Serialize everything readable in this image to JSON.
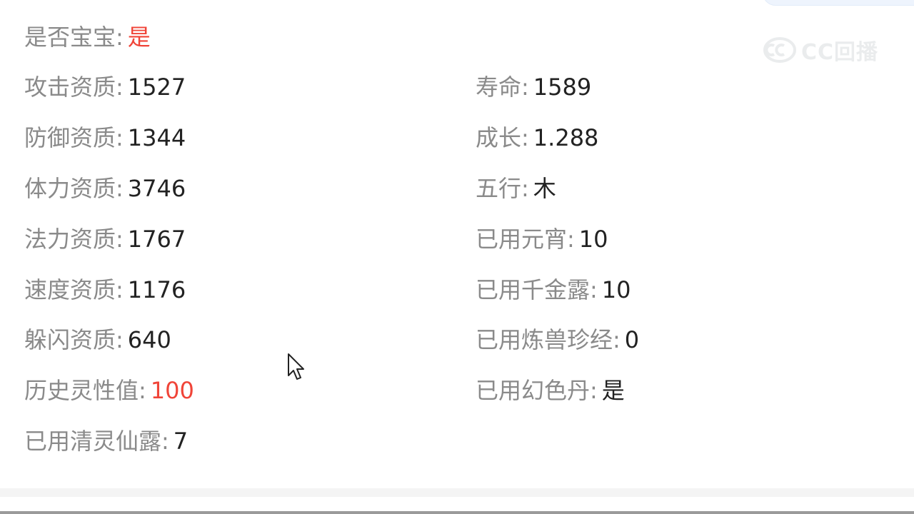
{
  "is_baby": {
    "label": "是否宝宝:",
    "value": "是"
  },
  "left_attributes": [
    {
      "label": "攻击资质:",
      "value": "1527"
    },
    {
      "label": "防御资质:",
      "value": "1344"
    },
    {
      "label": "体力资质:",
      "value": "3746"
    },
    {
      "label": "法力资质:",
      "value": "1767"
    },
    {
      "label": "速度资质:",
      "value": "1176"
    },
    {
      "label": "躲闪资质:",
      "value": "640"
    },
    {
      "label": "历史灵性值:",
      "value": "100"
    },
    {
      "label": "已用清灵仙露:",
      "value": "7"
    }
  ],
  "right_attributes": [
    {
      "label": "寿命:",
      "value": "1589"
    },
    {
      "label": "成长:",
      "value": "1.288"
    },
    {
      "label": "五行:",
      "value": "木"
    },
    {
      "label": "已用元宵:",
      "value": "10"
    },
    {
      "label": "已用千金露:",
      "value": "10"
    },
    {
      "label": "已用炼兽珍经:",
      "value": "0"
    },
    {
      "label": "已用幻色丹:",
      "value": "是"
    }
  ],
  "watermark": {
    "text": "CC回播",
    "icon": "cc-logo-icon"
  },
  "colors": {
    "label": "#8a8a8a",
    "value": "#222222",
    "highlight": "#f04438",
    "background": "#ffffff"
  }
}
